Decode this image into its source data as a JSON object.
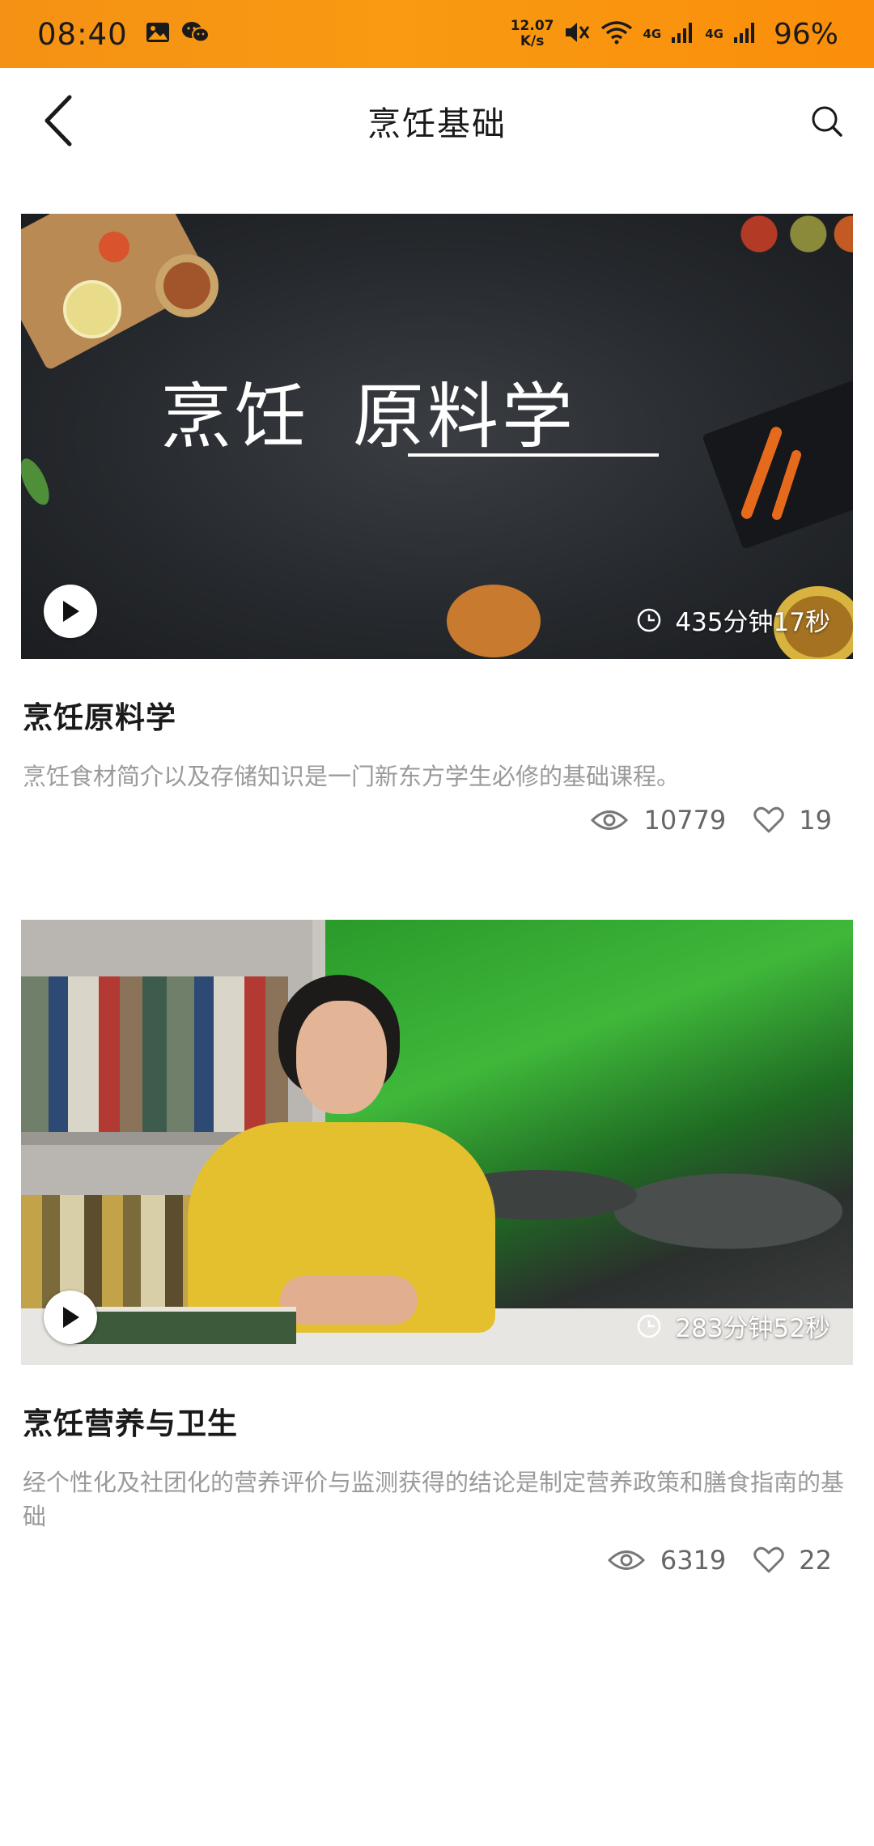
{
  "status_bar": {
    "time": "08:40",
    "net_speed_value": "12.07",
    "net_speed_unit": "K/s",
    "net_label_1": "4G",
    "net_label_2": "4G",
    "battery": "96%"
  },
  "header": {
    "title": "烹饪基础"
  },
  "courses": [
    {
      "thumbnail_text_1": "烹饪",
      "thumbnail_text_2": "原料学",
      "duration": "435分钟17秒",
      "title": "烹饪原料学",
      "description": "烹饪食材简介以及存储知识是一门新东方学生必修的基础课程。",
      "views": "10779",
      "likes": "19"
    },
    {
      "duration": "283分钟52秒",
      "title": "烹饪营养与卫生",
      "description": "经个性化及社团化的营养评价与监测获得的结论是制定营养政策和膳食指南的基础",
      "views": "6319",
      "likes": "22"
    }
  ],
  "colors": {
    "status_bar": "#f89a12",
    "text_primary": "#1a1a1a",
    "text_secondary": "#9a9a9a"
  }
}
